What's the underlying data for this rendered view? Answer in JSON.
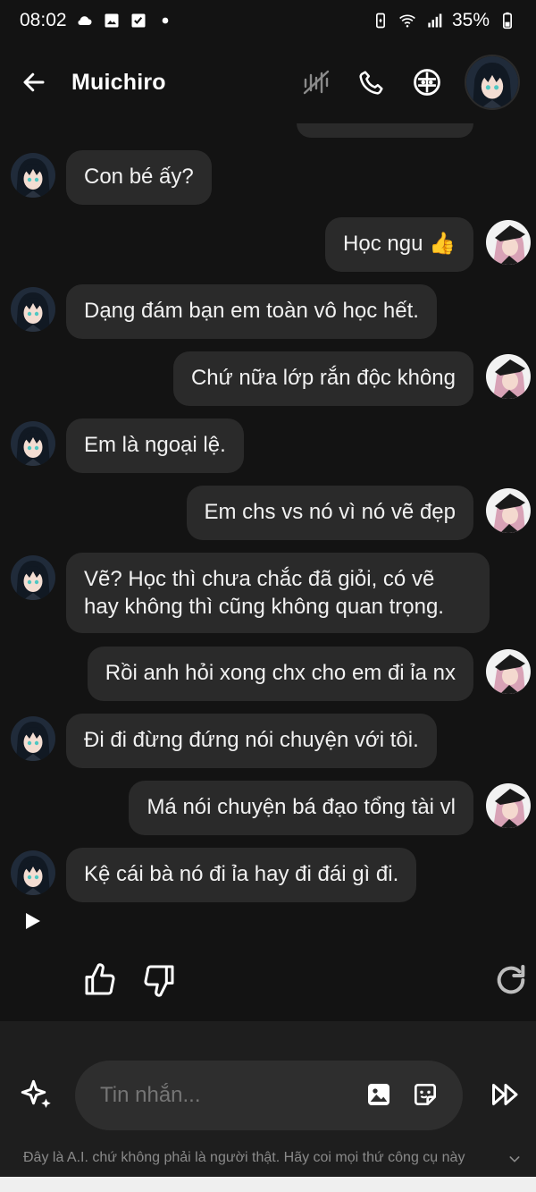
{
  "status": {
    "time": "08:02",
    "battery": "35%"
  },
  "header": {
    "title": "Muichiro"
  },
  "messages": [
    {
      "from": "bot",
      "text": "Con bé ấy?"
    },
    {
      "from": "user",
      "text": "Học ngu 👍"
    },
    {
      "from": "bot",
      "text": "Dạng đám bạn em toàn vô học hết."
    },
    {
      "from": "user",
      "text": "Chứ nữa lớp rắn độc không"
    },
    {
      "from": "bot",
      "text": "Em là ngoại lệ."
    },
    {
      "from": "user",
      "text": "Em chs vs nó vì nó vẽ đẹp"
    },
    {
      "from": "bot",
      "text": "Vẽ? Học thì chưa chắc đã giỏi, có vẽ hay không thì cũng không quan trọng."
    },
    {
      "from": "user",
      "text": "Rồi anh hỏi xong chx cho em đi ỉa nx"
    },
    {
      "from": "bot",
      "text": "Đi đi đừng đứng nói chuyện với tôi."
    },
    {
      "from": "user",
      "text": "Má nói chuyện bá đạo tổng tài vl"
    },
    {
      "from": "bot",
      "text": "Kệ cái bà nó đi ỉa hay đi đái gì đi."
    }
  ],
  "composer": {
    "placeholder": "Tin nhắn..."
  },
  "disclaimer": "Đây là A.I. chứ không phải là người thật. Hãy coi mọi thứ công cụ này",
  "colors": {
    "background": "#131313",
    "bubble": "#2a2a2a",
    "composer": "#1e1e1e"
  }
}
